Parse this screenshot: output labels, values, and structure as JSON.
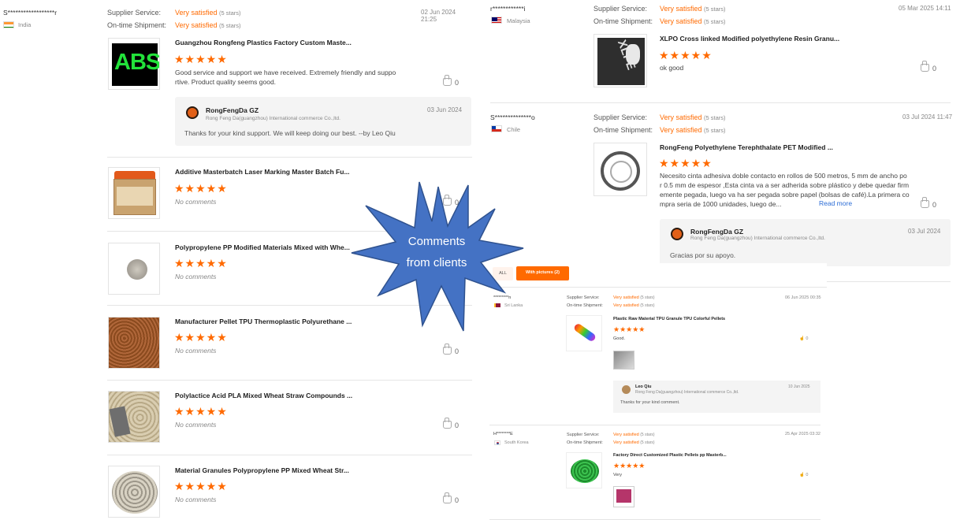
{
  "labels": {
    "service": "Supplier Service:",
    "shipment": "On-time Shipment:",
    "rating_text": "Very satisfied",
    "rating_count": "(5 stars)"
  },
  "reviews_left": [
    {
      "user": "S******************r",
      "country": "India",
      "date": "02 Jun 2024 21:25",
      "product": "Guangzhou Rongfeng Plastics Factory Custom Maste...",
      "comment_1": "Good service and support we have received. Extremely friendly and suppo",
      "comment_2": "rtive. Product quality seems good.",
      "likes": "0"
    },
    {
      "product": "Additive Masterbatch Laser Marking Master Batch Fu...",
      "comment": "No comments",
      "likes": "0"
    },
    {
      "product": "Polypropylene PP Modified Materials Mixed with Whe...",
      "comment": "No comments",
      "likes": "0"
    },
    {
      "product": "Manufacturer Pellet TPU Thermoplastic Polyurethane ...",
      "comment": "No comments",
      "likes": "0"
    },
    {
      "product": "Polylactice Acid PLA Mixed Wheat Straw Compounds ...",
      "comment": "No comments",
      "likes": "0"
    },
    {
      "product": "Material Granules Polypropylene PP Mixed Wheat Str...",
      "comment": "No comments",
      "likes": "0"
    }
  ],
  "reply_left": {
    "name": "RongFengDa GZ",
    "company": "Rong Feng Da(guangzhou) International commerce Co.,ltd.",
    "date": "03 Jun 2024",
    "text": "Thanks for your kind support. We will keep doing our best. --by Leo Qiu"
  },
  "abs_logo_text": "ABS",
  "reviews_right": [
    {
      "user": "r************i",
      "country": "Malaysia",
      "date": "05 Mar 2025 14:11",
      "product": "XLPO Cross linked Modified polyethylene Resin Granu...",
      "comment": "ok good",
      "likes": "0"
    },
    {
      "user": "S**************o",
      "country": "Chile",
      "date": "03 Jul 2024 11:47",
      "product": "RongFeng Polyethylene Terephthalate PET Modified ...",
      "comment_1": "Necesito cinta adhesiva doble contacto en rollos de 500 metros, 5 mm de ancho po",
      "comment_2": "r 0.5 mm de espesor ,Esta cinta va a ser adherida sobre plástico y debe quedar firm",
      "comment_3": "emente pegada, luego va ha ser pegada sobre papel (bolsas de café).La primera co",
      "comment_4": "mpra seria de 1000 unidades, luego de...",
      "read_more": "Read more",
      "likes": "0"
    }
  ],
  "reply_right": {
    "name": "RongFengDa GZ",
    "company": "Rong Feng Da(guangzhou) International commerce Co.,ltd.",
    "date": "03 Jul 2024",
    "text": "Gracias por su apoyo."
  },
  "callout": {
    "line1": "Comments",
    "line2": "from clients"
  },
  "filter_tabs": {
    "all": "ALL",
    "with_pictures": "With pictures (2)"
  },
  "mini_reviews": [
    {
      "user": "*********n",
      "country": "Sri Lanka",
      "date": "06 Jun 2025 00:35",
      "product": "Plastic Raw Material TPU Granule TPU Colorful Pellets",
      "comment": "Good.",
      "likes": "0",
      "reply_name": "Leo Qiu",
      "reply_company": "Rong Feng Da(guangzhou) International commerce Co.,ltd.",
      "reply_date": "10 Jun 2025",
      "reply_text": "Thanks for your kind comment."
    },
    {
      "user": "H********E",
      "country": "South Korea",
      "date": "25 Apr 2025 03:32",
      "product": "Factory Direct Customized Plastic Pellets pp Masterb...",
      "comment": "Very",
      "likes": "0"
    }
  ],
  "colors": {
    "accent": "#ff6a00",
    "callout": "#4472c4"
  }
}
